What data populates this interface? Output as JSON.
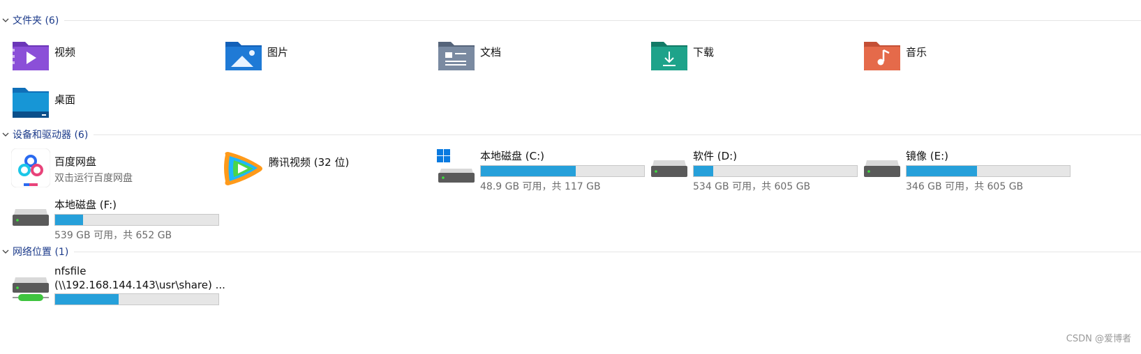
{
  "sections": {
    "folders": {
      "title": "文件夹 (6)"
    },
    "devices": {
      "title": "设备和驱动器 (6)"
    },
    "network": {
      "title": "网络位置 (1)"
    }
  },
  "folders": [
    {
      "label": "视频",
      "icon": "video-folder-icon",
      "color": "#8b4fd8"
    },
    {
      "label": "图片",
      "icon": "pictures-folder-icon",
      "color": "#1f7ad6"
    },
    {
      "label": "文档",
      "icon": "documents-folder-icon",
      "color": "#6f7f95"
    },
    {
      "label": "下载",
      "icon": "downloads-folder-icon",
      "color": "#1ea38a"
    },
    {
      "label": "音乐",
      "icon": "music-folder-icon",
      "color": "#e56a4a"
    },
    {
      "label": "桌面",
      "icon": "desktop-folder-icon",
      "color": "#1796d6"
    }
  ],
  "devices": {
    "baidu": {
      "label": "百度网盘",
      "sub": "双击运行百度网盘",
      "icon": "baidu-netdisk-icon"
    },
    "tencent": {
      "label": "腾讯视频 (32 位)",
      "icon": "tencent-video-icon"
    },
    "drives": [
      {
        "label": "本地磁盘 (C:)",
        "usage": "48.9 GB 可用，共 117 GB",
        "used_fraction": 0.58,
        "icon": "system-drive-icon"
      },
      {
        "label": "软件 (D:)",
        "usage": "534 GB 可用，共 605 GB",
        "used_fraction": 0.12,
        "icon": "hard-drive-icon"
      },
      {
        "label": "镜像 (E:)",
        "usage": "346 GB 可用，共 605 GB",
        "used_fraction": 0.43,
        "icon": "hard-drive-icon"
      },
      {
        "label": "本地磁盘 (F:)",
        "usage": "539 GB 可用，共 652 GB",
        "used_fraction": 0.17,
        "icon": "hard-drive-icon"
      }
    ]
  },
  "network": {
    "name": "nfsfile",
    "path": "(\\\\192.168.144.143\\usr\\share) ...",
    "used_fraction": 0.39,
    "icon": "network-drive-icon"
  },
  "watermark": "CSDN @爱博者",
  "colors": {
    "accent": "#26a0da",
    "section_title": "#1b3a8a"
  }
}
